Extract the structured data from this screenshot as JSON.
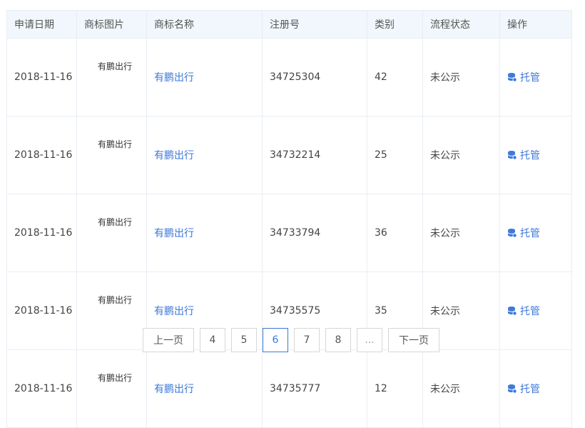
{
  "table": {
    "headers": [
      "申请日期",
      "商标图片",
      "商标名称",
      "注册号",
      "类别",
      "流程状态",
      "操作"
    ],
    "rows": [
      {
        "date": "2018-11-16",
        "logo_text": "有鹏出行",
        "name": "有鹏出行",
        "reg_no": "34725304",
        "category": "42",
        "status": "未公示",
        "action": "托管"
      },
      {
        "date": "2018-11-16",
        "logo_text": "有鹏出行",
        "name": "有鹏出行",
        "reg_no": "34732214",
        "category": "25",
        "status": "未公示",
        "action": "托管"
      },
      {
        "date": "2018-11-16",
        "logo_text": "有鹏出行",
        "name": "有鹏出行",
        "reg_no": "34733794",
        "category": "36",
        "status": "未公示",
        "action": "托管"
      },
      {
        "date": "2018-11-16",
        "logo_text": "有鹏出行",
        "name": "有鹏出行",
        "reg_no": "34735575",
        "category": "35",
        "status": "未公示",
        "action": "托管"
      },
      {
        "date": "2018-11-16",
        "logo_text": "有鹏出行",
        "name": "有鹏出行",
        "reg_no": "34735777",
        "category": "12",
        "status": "未公示",
        "action": "托管"
      }
    ],
    "action_icon": "database-icon"
  },
  "pagination": {
    "prev_label": "上一页",
    "pages": [
      "4",
      "5",
      "6",
      "7",
      "8"
    ],
    "ellipsis": "...",
    "next_label": "下一页",
    "current_page": "6"
  },
  "colors": {
    "link": "#3c78d8",
    "header_bg": "#f1f7fc",
    "border": "#e8edf3"
  }
}
